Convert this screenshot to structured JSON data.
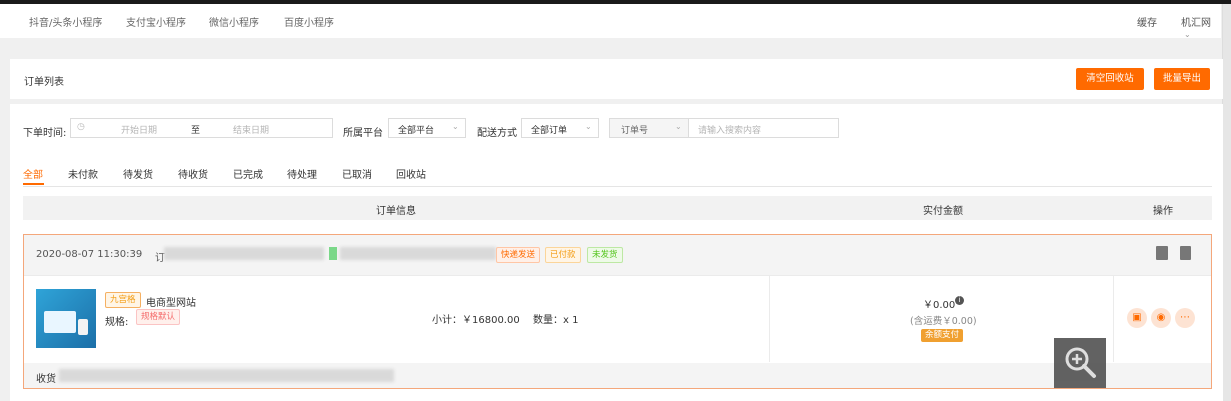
{
  "nav": {
    "tabs": [
      "抖音/头条小程序",
      "支付宝小程序",
      "微信小程序",
      "百度小程序"
    ],
    "cache": "缓存",
    "user": "机汇网"
  },
  "list": {
    "title": "订单列表",
    "clear_btn": "清空回收站",
    "export_btn": "批量导出"
  },
  "filters": {
    "time_label": "下单时间:",
    "start_ph": "开始日期",
    "to": "至",
    "end_ph": "结束日期",
    "platform_label": "所属平台",
    "platform_value": "全部平台",
    "delivery_label": "配送方式",
    "delivery_value": "全部订单",
    "order_field": "订单号",
    "search_ph": "请输入搜索内容"
  },
  "tabs": [
    "全部",
    "未付款",
    "待发货",
    "待收货",
    "已完成",
    "待处理",
    "已取消",
    "回收站"
  ],
  "table_head": {
    "info": "订单信息",
    "amount": "实付金额",
    "ops": "操作"
  },
  "order": {
    "time": "2020-08-07 11:30:39",
    "order_prefix": "订",
    "tags": [
      "快递发送",
      "已付款",
      "未发货"
    ],
    "product_tag": "九宫格",
    "product_name": "电商型网站",
    "spec_label": "规格:",
    "spec_value": "规格默认",
    "subtotal": "小计：￥16800.00",
    "qty": "数量：x 1",
    "price": "￥0.00",
    "shipping": "(含运费￥0.00)",
    "pay_method": "余额支付",
    "receiver_label": "收货"
  },
  "colors": {
    "accent": "#ff6a00",
    "order_border": "#f4a77b"
  }
}
